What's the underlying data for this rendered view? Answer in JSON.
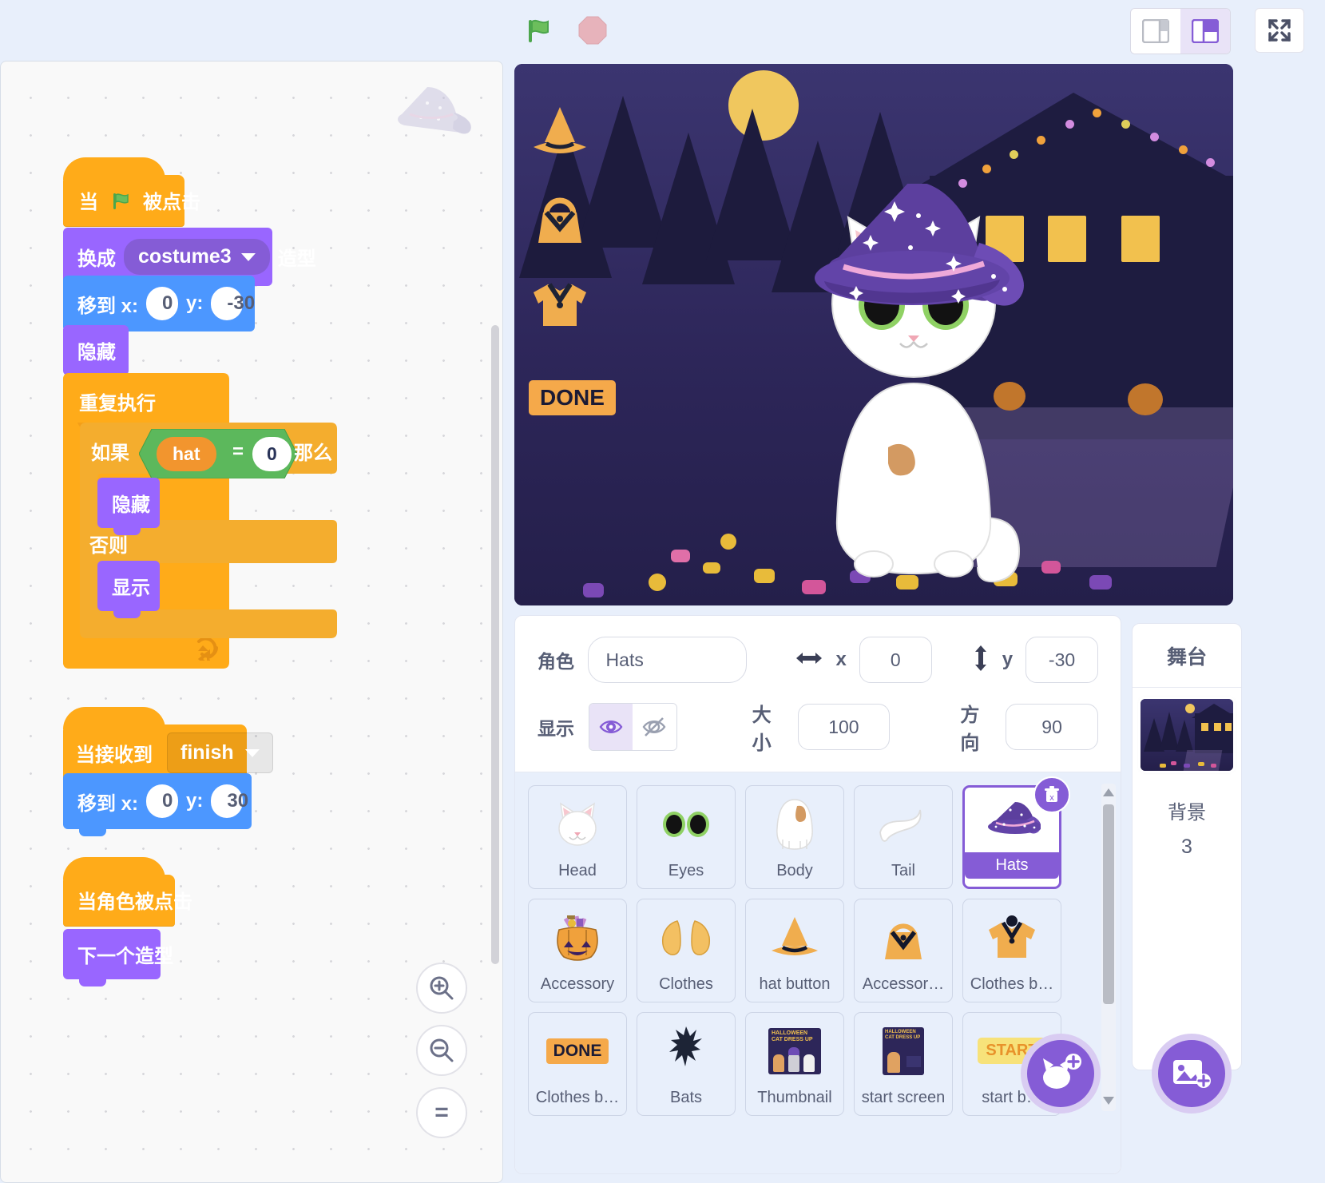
{
  "toolbar": {
    "green_flag_icon": "green-flag-icon",
    "stop_icon": "stop-sign-icon",
    "small_stage_icon": "small-stage-layout-icon",
    "large_stage_icon": "large-stage-layout-icon",
    "fullscreen_icon": "fullscreen-icon"
  },
  "code": {
    "zoom_in_icon": "zoom-in-icon",
    "zoom_out_icon": "zoom-out-icon",
    "zoom_reset_label": "=",
    "watermark_icon": "witch-hat-watermark-icon",
    "scripts": [
      {
        "id": "script1",
        "blocks": [
          {
            "type": "hat",
            "text_before": "当",
            "icon": "green-flag-icon",
            "text_after": "被点击"
          },
          {
            "type": "looks",
            "text_before": "换成",
            "dropdown": "costume3",
            "text_after": "造型"
          },
          {
            "type": "motion",
            "text_before": "移到 x:",
            "x": "0",
            "y_label": "y:",
            "y": "-30"
          },
          {
            "type": "looks",
            "text": "隐藏"
          },
          {
            "type": "control",
            "text": "重复执行"
          },
          {
            "type": "control_if",
            "text_before": "如果",
            "operand_left": "hat",
            "operator": "=",
            "operand_right": "0",
            "text_after": "那么"
          },
          {
            "type": "looks",
            "text": "隐藏"
          },
          {
            "type": "control_else",
            "text": "否则"
          },
          {
            "type": "looks",
            "text": "显示"
          }
        ]
      },
      {
        "id": "script2",
        "blocks": [
          {
            "type": "hat_event",
            "text": "当接收到",
            "dropdown": "finish"
          },
          {
            "type": "motion",
            "text_before": "移到 x:",
            "x": "0",
            "y_label": "y:",
            "y": "30"
          }
        ]
      },
      {
        "id": "script3",
        "blocks": [
          {
            "type": "hat_event_click",
            "text": "当角色被点击"
          },
          {
            "type": "looks",
            "text": "下一个造型"
          }
        ]
      }
    ]
  },
  "stage": {
    "done_button_label": "DONE",
    "side_icons": [
      "hat-icon",
      "accessory-bag-icon",
      "clothes-shirt-icon"
    ]
  },
  "sprite_info": {
    "name_label": "角色",
    "name_value": "Hats",
    "x_label": "x",
    "x_value": "0",
    "y_label": "y",
    "y_value": "-30",
    "visible_label": "显示",
    "show_icon": "eye-show-icon",
    "hide_icon": "eye-hide-icon",
    "size_label": "大小",
    "size_value": "100",
    "direction_label": "方向",
    "direction_value": "90",
    "x_arrow_icon": "horizontal-arrow-icon",
    "y_arrow_icon": "vertical-arrow-icon"
  },
  "sprites": [
    {
      "name": "Head",
      "thumb": "cat-head-icon",
      "selected": false
    },
    {
      "name": "Eyes",
      "thumb": "cat-eyes-icon",
      "selected": false
    },
    {
      "name": "Body",
      "thumb": "cat-body-icon",
      "selected": false
    },
    {
      "name": "Tail",
      "thumb": "cat-tail-icon",
      "selected": false
    },
    {
      "name": "Hats",
      "thumb": "witch-hat-icon",
      "selected": true
    },
    {
      "name": "Accessory",
      "thumb": "pumpkin-basket-icon",
      "selected": false
    },
    {
      "name": "Clothes",
      "thumb": "wings-icon",
      "selected": false
    },
    {
      "name": "hat button",
      "thumb": "hat-button-icon",
      "selected": false
    },
    {
      "name": "Accessor…",
      "thumb": "bag-button-icon",
      "selected": false
    },
    {
      "name": "Clothes b…",
      "thumb": "shirt-button-icon",
      "selected": false
    },
    {
      "name": "Clothes b…",
      "thumb": "done-chip-icon",
      "selected": false
    },
    {
      "name": "Bats",
      "thumb": "bat-icon",
      "selected": false
    },
    {
      "name": "Thumbnail",
      "thumb": "thumbnail-poster-icon",
      "selected": false
    },
    {
      "name": "start screen",
      "thumb": "start-screen-icon",
      "selected": false
    },
    {
      "name": "start b…",
      "thumb": "start-button-icon",
      "selected": false
    }
  ],
  "sprite_actions": {
    "delete_icon": "delete-trash-icon",
    "add_sprite_icon": "add-sprite-cat-icon",
    "add_backdrop_icon": "add-backdrop-image-icon"
  },
  "stage_panel": {
    "title": "舞台",
    "backdrop_label": "背景",
    "backdrop_count": "3",
    "thumbnail": "halloween-house-backdrop"
  }
}
